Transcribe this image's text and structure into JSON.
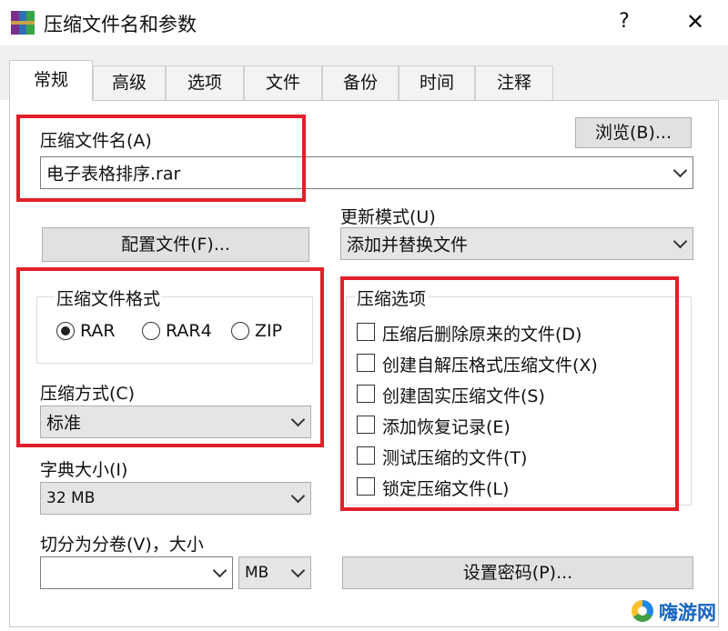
{
  "window": {
    "title": "压缩文件名和参数",
    "help_label": "?",
    "close_label": "✕"
  },
  "tabs": [
    {
      "label": "常规"
    },
    {
      "label": "高级"
    },
    {
      "label": "选项"
    },
    {
      "label": "文件"
    },
    {
      "label": "备份"
    },
    {
      "label": "时间"
    },
    {
      "label": "注释"
    }
  ],
  "archive_name": {
    "label": "压缩文件名(A)",
    "value": "电子表格排序.rar",
    "browse_label": "浏览(B)..."
  },
  "profiles_button": "配置文件(F)...",
  "update_mode": {
    "label": "更新模式(U)",
    "value": "添加并替换文件"
  },
  "archive_format": {
    "label": "压缩文件格式",
    "options": [
      {
        "label": "RAR",
        "selected": true
      },
      {
        "label": "RAR4",
        "selected": false
      },
      {
        "label": "ZIP",
        "selected": false
      }
    ]
  },
  "compression_method": {
    "label": "压缩方式(C)",
    "value": "标准"
  },
  "dictionary_size": {
    "label": "字典大小(I)",
    "value": "32 MB"
  },
  "split_volumes": {
    "label": "切分为分卷(V)，大小",
    "value": "",
    "unit": "MB"
  },
  "archiving_options": {
    "label": "压缩选项",
    "items": [
      {
        "label": "压缩后删除原来的文件(D)",
        "checked": false
      },
      {
        "label": "创建自解压格式压缩文件(X)",
        "checked": false
      },
      {
        "label": "创建固实压缩文件(S)",
        "checked": false
      },
      {
        "label": "添加恢复记录(E)",
        "checked": false
      },
      {
        "label": "测试压缩的文件(T)",
        "checked": false
      },
      {
        "label": "锁定压缩文件(L)",
        "checked": false
      }
    ]
  },
  "password_button": "设置密码(P)...",
  "watermark": {
    "text": "嗨游网"
  },
  "colors": {
    "highlight_border": "#e0202a",
    "button_face": "#e1e1e1",
    "tab_strip": "#f0f0f0"
  }
}
